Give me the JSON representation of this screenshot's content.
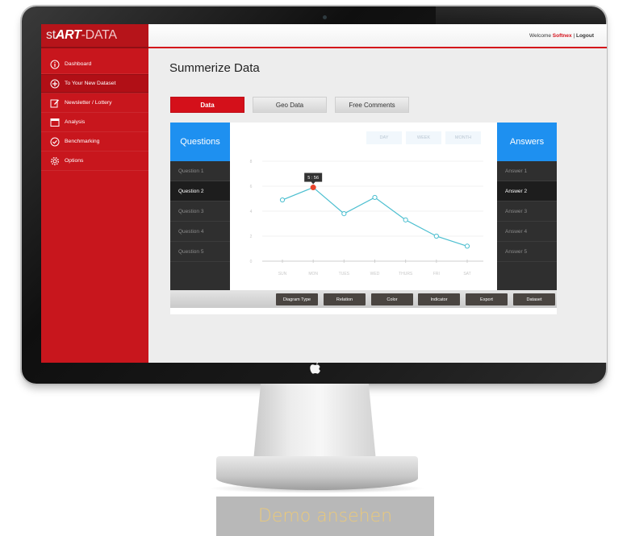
{
  "app": {
    "logo_part1": "st",
    "logo_part2": "ART",
    "logo_part3": "-DATA"
  },
  "header": {
    "welcome_prefix": "Welcome",
    "username": "Softnex",
    "separator": "|",
    "logout_label": "Logout"
  },
  "sidebar": {
    "items": [
      {
        "label": "Dashboard",
        "icon": "info-icon"
      },
      {
        "label": "To Your New Dataset",
        "icon": "plus-circle-icon"
      },
      {
        "label": "Newsletter / Lottery",
        "icon": "edit-icon"
      },
      {
        "label": "Analysis",
        "icon": "window-icon"
      },
      {
        "label": "Benchmarking",
        "icon": "check-circle-icon"
      },
      {
        "label": "Options",
        "icon": "gear-icon"
      }
    ]
  },
  "main": {
    "title": "Summerize Data",
    "tabs": [
      {
        "label": "Data"
      },
      {
        "label": "Geo Data"
      },
      {
        "label": "Free Comments"
      }
    ],
    "questions_header": "Questions",
    "answers_header": "Answers",
    "questions": [
      "Question 1",
      "Question 2",
      "Question 3",
      "Question 4",
      "Question 5"
    ],
    "answers": [
      "Answer 1",
      "Answer 2",
      "Answer 3",
      "Answer 4",
      "Answer 5"
    ],
    "range_buttons": [
      "DAY",
      "WEEK",
      "MONTH"
    ],
    "toolbar": [
      "Diagram Type",
      "Relation",
      "Color",
      "Indicator",
      "Export",
      "Dataset"
    ]
  },
  "chart_data": {
    "type": "line",
    "categories": [
      "SUN",
      "MON",
      "TUES",
      "WED",
      "THURS",
      "FRI",
      "SAT"
    ],
    "values": [
      4.9,
      5.9,
      3.8,
      5.1,
      3.3,
      2.0,
      1.2
    ],
    "y_ticks": [
      "0",
      "2",
      "4",
      "6",
      "8"
    ],
    "ylim": [
      0,
      8
    ],
    "tooltip": "5 : 56",
    "highlight_index": 1,
    "colors": {
      "line": "#4cbfd0",
      "highlight": "#e8452c",
      "tooltip_bg": "#333333"
    }
  },
  "cta": {
    "label": "Demo ansehen"
  },
  "colors": {
    "brand_red": "#d4101a",
    "accent_blue": "#1e90f0",
    "dark": "#2f2f2f",
    "cta_text": "#eac97a"
  }
}
